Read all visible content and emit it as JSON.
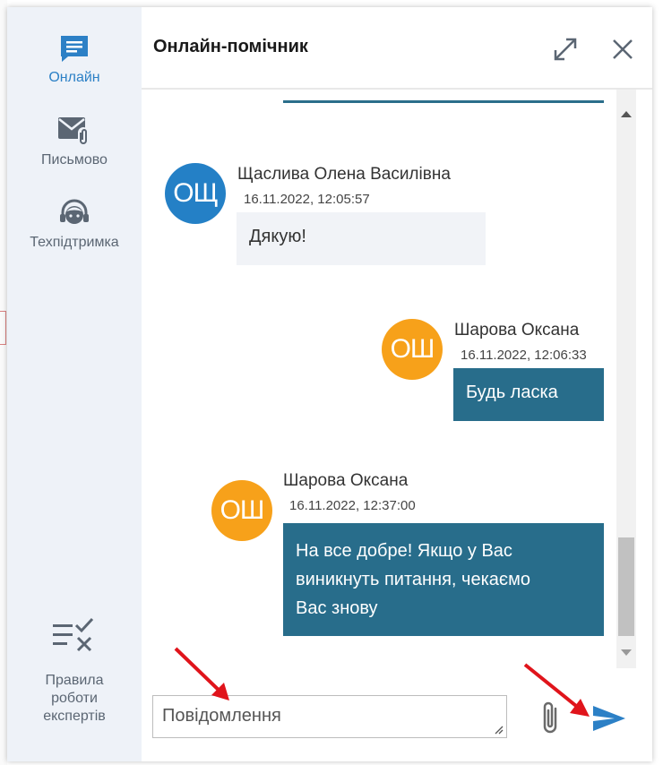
{
  "sidebar": {
    "items": [
      {
        "label": "Онлайн",
        "icon": "chat-icon",
        "active": true
      },
      {
        "label": "Письмово",
        "icon": "mail-attach-icon",
        "active": false
      },
      {
        "label": "Техпідтримка",
        "icon": "headset-icon",
        "active": false
      }
    ],
    "rules": {
      "line1": "Правила",
      "line2": "роботи",
      "line3": "експертів",
      "icon": "list-check-icon"
    }
  },
  "header": {
    "title": "Онлайн-помічник",
    "expand_icon": "expand-icon",
    "close_icon": "close-icon"
  },
  "messages": [
    {
      "initials": "ОЩ",
      "author": "Щаслива Олена Василівна",
      "time": "16.11.2022, 12:05:57",
      "text": "Дякую!",
      "color": "#2480c6"
    },
    {
      "initials": "ОШ",
      "author": "Шарова Оксана",
      "time": "16.11.2022, 12:06:33",
      "text": "Будь ласка",
      "color": "#f7a11a"
    },
    {
      "initials": "ОШ",
      "author": "Шарова Оксана",
      "time": "16.11.2022, 12:37:00",
      "text_lines": [
        "На все добре! Якщо у Вас",
        "виникнуть питання, чекаємо",
        "Вас знову"
      ],
      "color": "#f7a11a"
    }
  ],
  "composer": {
    "placeholder": "Повідомлення",
    "attach_icon": "paperclip-icon",
    "send_icon": "send-icon"
  },
  "colors": {
    "accent": "#2c80c6",
    "bubble_dark": "#286d8b",
    "bubble_light": "#f1f3f7",
    "sidebar_bg": "#eef2f8",
    "annotation_arrow": "#e0141b"
  }
}
